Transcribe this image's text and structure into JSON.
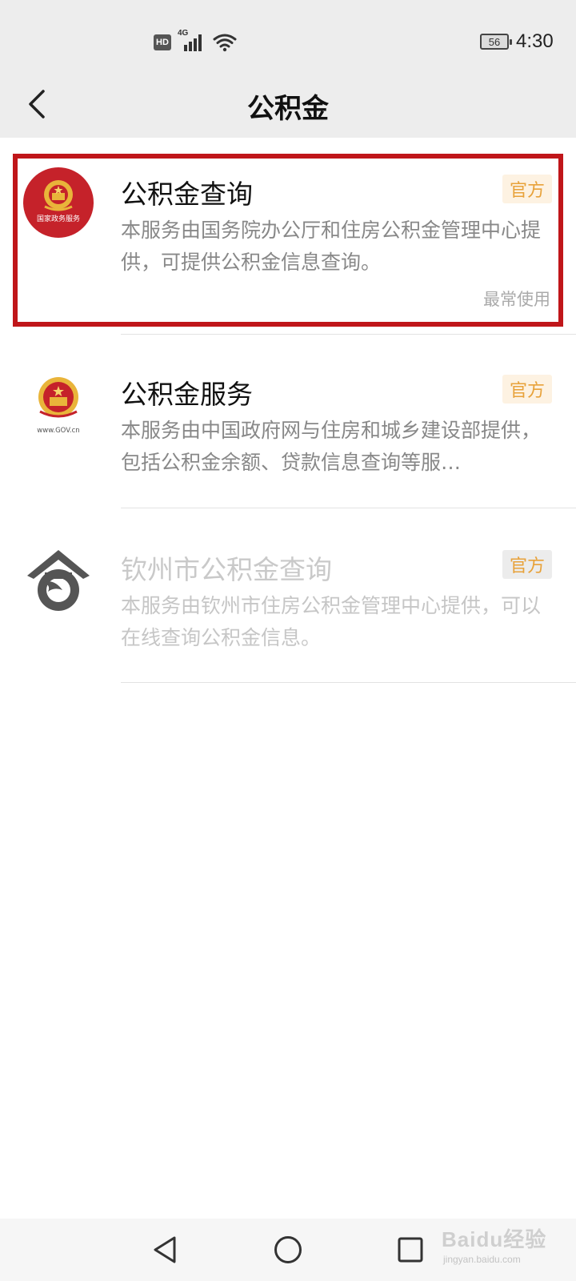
{
  "status_bar": {
    "hd": "HD",
    "network": "4G",
    "battery": "56",
    "time": "4:30"
  },
  "header": {
    "title": "公积金",
    "back_icon": "chevron-left-icon"
  },
  "services": [
    {
      "title": "公积金查询",
      "badge": "官方",
      "description": "本服务由国务院办公厅和住房公积金管理中心提供，可提供公积金信息查询。",
      "frequency_label": "最常使用",
      "logo_text": "国家政务服务",
      "highlighted": true
    },
    {
      "title": "公积金服务",
      "badge": "官方",
      "description": "本服务由中国政府网与住房和城乡建设部提供，包括公积金余额、贷款信息查询等服…",
      "logo_text": "www.GOV.cn"
    },
    {
      "title": "钦州市公积金查询",
      "badge": "官方",
      "description": "本服务由钦州市住房公积金管理中心提供，可以在线查询公积金信息。",
      "disabled": true
    }
  ],
  "nav_bar": {
    "back_icon": "triangle-back-icon",
    "home_icon": "circle-home-icon",
    "recent_icon": "square-recent-icon"
  },
  "watermark": {
    "brand": "Baidu经验",
    "url": "jingyan.baidu.com"
  },
  "colors": {
    "highlight_border": "#c0161a",
    "badge_text": "#e8a23a",
    "badge_bg": "#fdf2e2",
    "header_bg": "#ededed"
  }
}
